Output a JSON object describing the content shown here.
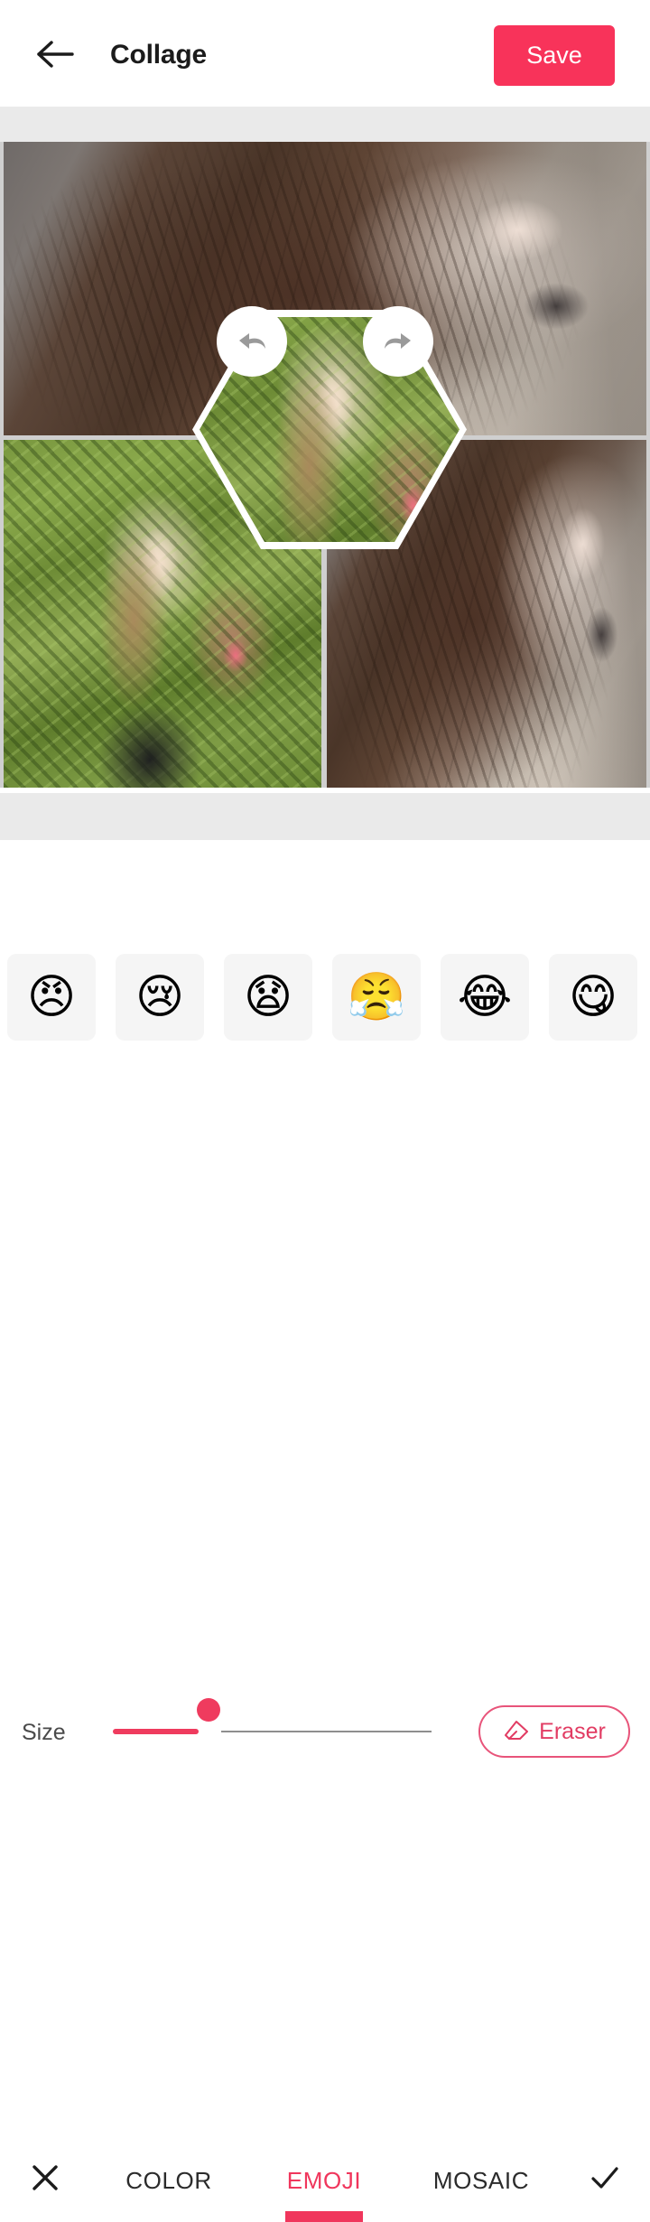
{
  "header": {
    "title": "Collage",
    "back_icon": "arrow-left-icon",
    "save_label": "Save",
    "save_color": "#f8335a"
  },
  "canvas": {
    "undo_icon": "undo-arrow-icon",
    "redo_icon": "redo-arrow-icon",
    "cells": [
      {
        "name": "photo-top",
        "description": "woman lying on railway tracks with long flowing hair"
      },
      {
        "name": "photo-bottom-left",
        "description": "woman in black dress holding flowers in front of green ivy"
      },
      {
        "name": "photo-bottom-right",
        "description": "woman with flowing hair on railway tracks"
      }
    ],
    "hexagon_overlay": {
      "shape": "hexagon",
      "border_color": "#ffffff",
      "description": "woman in black dress holding flowers in front of green ivy"
    }
  },
  "size_control": {
    "label": "Size",
    "value_percent": 27,
    "track_color": "#8e8e8e",
    "fill_color": "#ef3b5e",
    "thumb_color": "#ef3b5e"
  },
  "eraser": {
    "label": "Eraser",
    "icon": "eraser-icon",
    "color": "#e23c63"
  },
  "emoji_strip": [
    {
      "name": "emoji-angry",
      "glyph": "😠",
      "label": "angry face"
    },
    {
      "name": "emoji-crying",
      "glyph": "😢",
      "label": "crying face"
    },
    {
      "name": "emoji-anguished",
      "glyph": "😧",
      "label": "anguished face"
    },
    {
      "name": "emoji-triumph",
      "glyph": "😤",
      "label": "face with steam from nose"
    },
    {
      "name": "emoji-joy",
      "glyph": "😂",
      "label": "face with tears of joy"
    },
    {
      "name": "emoji-yum",
      "glyph": "😋",
      "label": "face savoring food"
    }
  ],
  "tabbar": {
    "close_icon": "close-x-icon",
    "done_icon": "check-icon",
    "active_tab": "EMOJI",
    "active_color": "#f0365c",
    "tabs": [
      {
        "label": "COLOR",
        "active": false
      },
      {
        "label": "EMOJI",
        "active": true
      },
      {
        "label": "MOSAIC",
        "active": false
      }
    ]
  }
}
